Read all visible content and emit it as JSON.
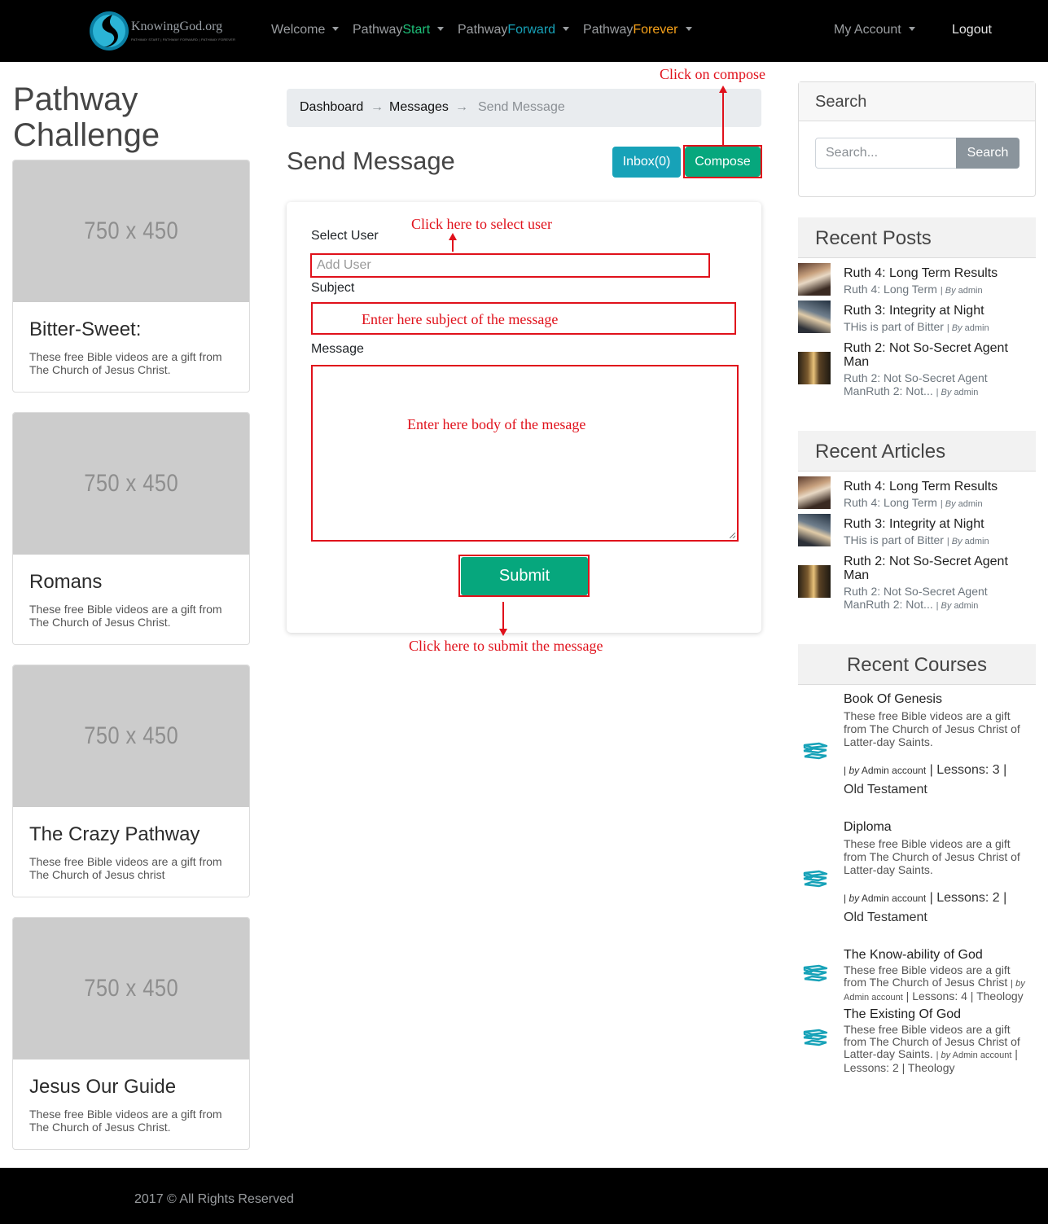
{
  "navbar": {
    "logo_text": "KnowingGod.org",
    "logo_subtext": "PATHWAY START | PATHWAY FORWARD | PATHWAY FOREVER",
    "welcome": "Welcome",
    "pathway_word": "Pathway",
    "start": "Start",
    "forward": "Forward",
    "forever": "Forever",
    "my_account": "My Account",
    "logout": "Logout"
  },
  "left": {
    "title": "Pathway Challenge",
    "cards": [
      {
        "image_placeholder": "750 x 450",
        "title": "Bitter-Sweet:",
        "text": "These free Bible videos are a gift from The Church of Jesus Christ."
      },
      {
        "image_placeholder": "750 x 450",
        "title": "Romans",
        "text": "These free Bible videos are a gift from The Church of Jesus Christ."
      },
      {
        "image_placeholder": "750 x 450",
        "title": "The Crazy Pathway",
        "text": "These free Bible videos are a gift from The Church of Jesus christ"
      },
      {
        "image_placeholder": "750 x 450",
        "title": "Jesus Our Guide",
        "text": "These free Bible videos are a gift from The Church of Jesus Christ."
      }
    ]
  },
  "breadcrumb": {
    "dashboard": "Dashboard",
    "messages": "Messages",
    "current": "Send Message",
    "separator": "→"
  },
  "main": {
    "title": "Send Message",
    "inbox_button": "Inbox(0)",
    "compose_button": "Compose",
    "select_user_label": "Select User",
    "user_placeholder": "Add User",
    "subject_label": "Subject",
    "message_label": "Message",
    "submit_button": "Submit"
  },
  "annotations": {
    "compose": "Click on compose",
    "select_user": "Click here to select user",
    "subject": "Enter here subject of the message",
    "body": "Enter here body of the mesage",
    "submit": "Click here to submit the message",
    "color": "#e0111b"
  },
  "sidebar": {
    "search_title": "Search",
    "search_placeholder": "Search...",
    "search_button": "Search",
    "recent_posts_title": "Recent Posts",
    "recent_articles_title": "Recent Articles",
    "recent_courses_title": "Recent Courses",
    "by_label": "By",
    "author": "admin",
    "posts": [
      {
        "title": "Ruth 4: Long Term Results",
        "desc": "Ruth 4: Long Term"
      },
      {
        "title": "Ruth 3: Integrity at Night",
        "desc": "THis is part of Bitter"
      },
      {
        "title": "Ruth 2: Not So-Secret Agent Man",
        "desc": "Ruth 2: Not So-Secret Agent ManRuth 2: Not..."
      }
    ],
    "articles": [
      {
        "title": "Ruth 4: Long Term Results",
        "desc": "Ruth 4: Long Term"
      },
      {
        "title": "Ruth 3: Integrity at Night",
        "desc": "THis is part of Bitter"
      },
      {
        "title": "Ruth 2: Not So-Secret Agent Man",
        "desc": "Ruth 2: Not So-Secret Agent ManRuth 2: Not..."
      }
    ],
    "courses_by": "by",
    "courses_author": "Admin account",
    "lessons_label": "Lessons:",
    "courses": [
      {
        "title": "Book Of Genesis",
        "desc": "These free Bible videos are a gift from The Church of Jesus Christ of Latter-day Saints.",
        "lessons": "3",
        "category": "Old Testament"
      },
      {
        "title": "Diploma",
        "desc": "These free Bible videos are a gift from The Church of Jesus Christ of Latter-day Saints.",
        "lessons": "2",
        "category": "Old Testament"
      },
      {
        "title": "The Know-ability of God",
        "desc": "These free Bible videos are a gift from The Church of Jesus Christ",
        "lessons": "4",
        "category": "Theology"
      },
      {
        "title": "The Existing Of God",
        "desc": "These free Bible videos are a gift from The Church of Jesus Christ of Latter-day Saints.",
        "lessons": "2",
        "category": "Theology"
      }
    ]
  },
  "footer": {
    "text": "2017 © All Rights Reserved"
  },
  "colors": {
    "navbar_bg": "#000000",
    "accent_green": "#06a77d",
    "accent_teal": "#17a2b8",
    "start_green": "#1ec17a",
    "forever_orange": "#f7a21a"
  },
  "icons": [
    "logo-icon",
    "chevron-down-icon",
    "book-stack-icon"
  ]
}
